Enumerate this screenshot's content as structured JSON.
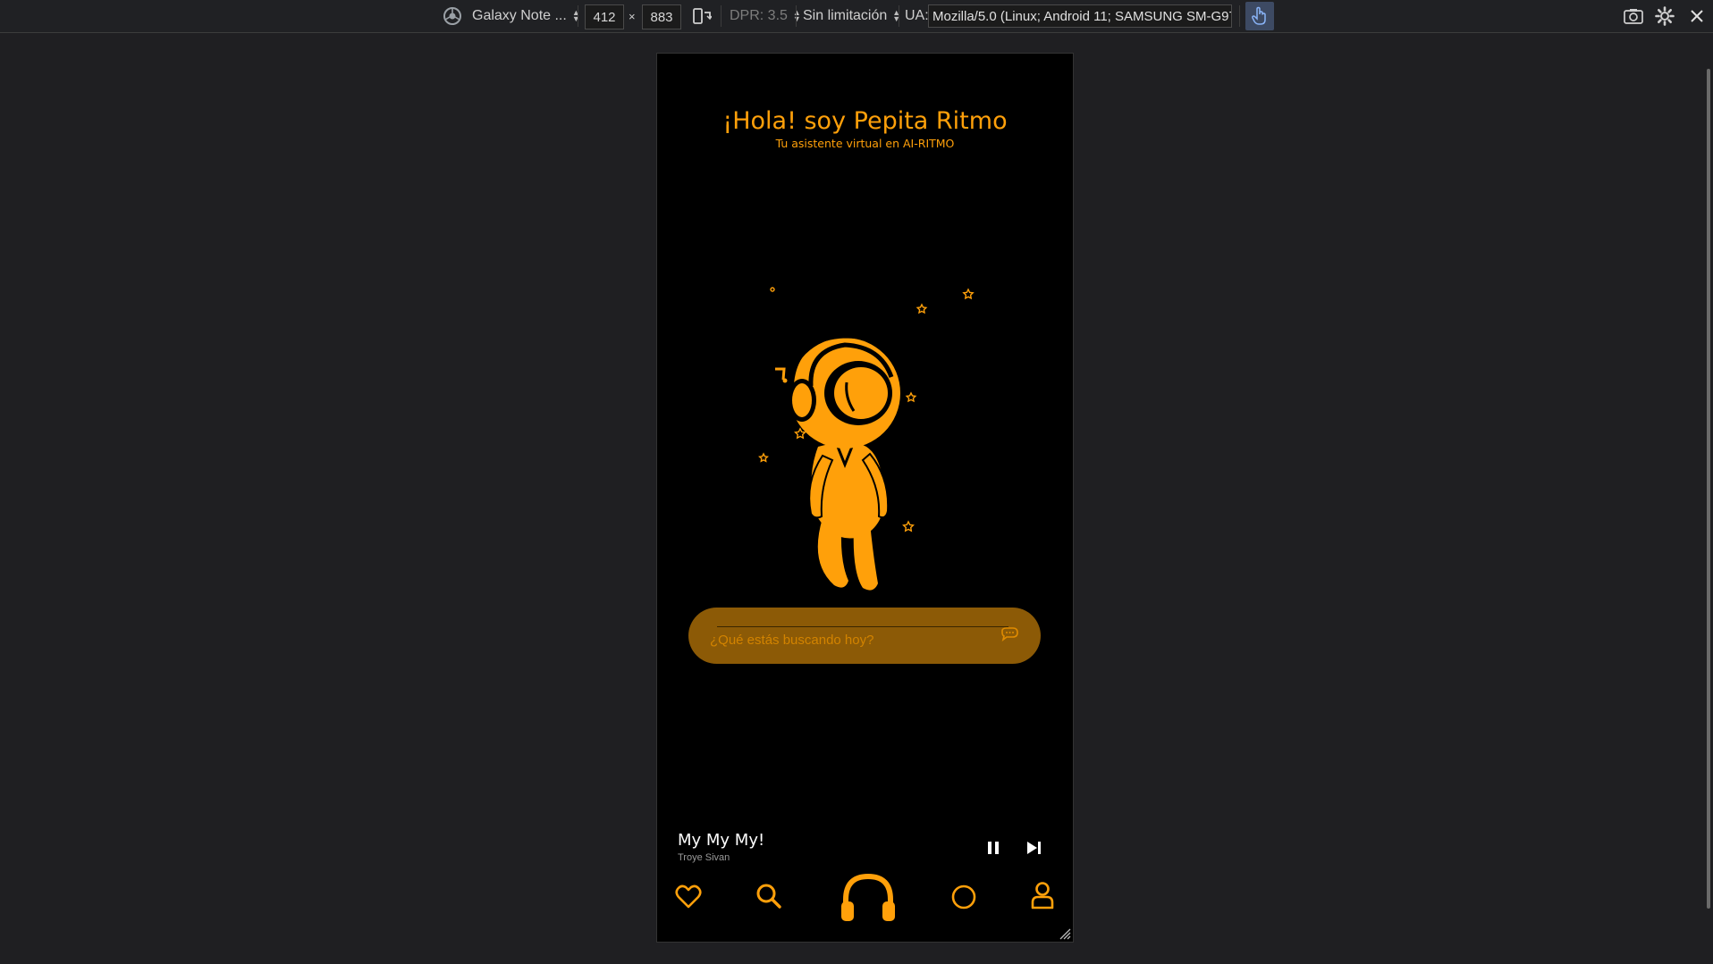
{
  "devtools": {
    "device": "Galaxy Note ...",
    "width": "412",
    "times": "×",
    "height": "883",
    "dpr": "DPR: 3.5",
    "throttle": "Sin limitación",
    "ua_label": "UA:",
    "ua_value": "Mozilla/5.0 (Linux; Android 11; SAMSUNG SM-G97"
  },
  "app": {
    "title": "¡Hola! soy Pepita Ritmo",
    "subtitle": "Tu asistente virtual en AI-RITMO",
    "search_placeholder": "¿Qué estás buscando hoy?",
    "now_playing": {
      "title": "My My My!",
      "artist": "Troye Sivan"
    },
    "nav": [
      "heart-icon",
      "search-icon",
      "headphones-icon",
      "circle-icon",
      "user-icon"
    ],
    "colors": {
      "accent": "#ffa00a",
      "search_bg": "#8c5a06",
      "background": "#000000"
    }
  }
}
